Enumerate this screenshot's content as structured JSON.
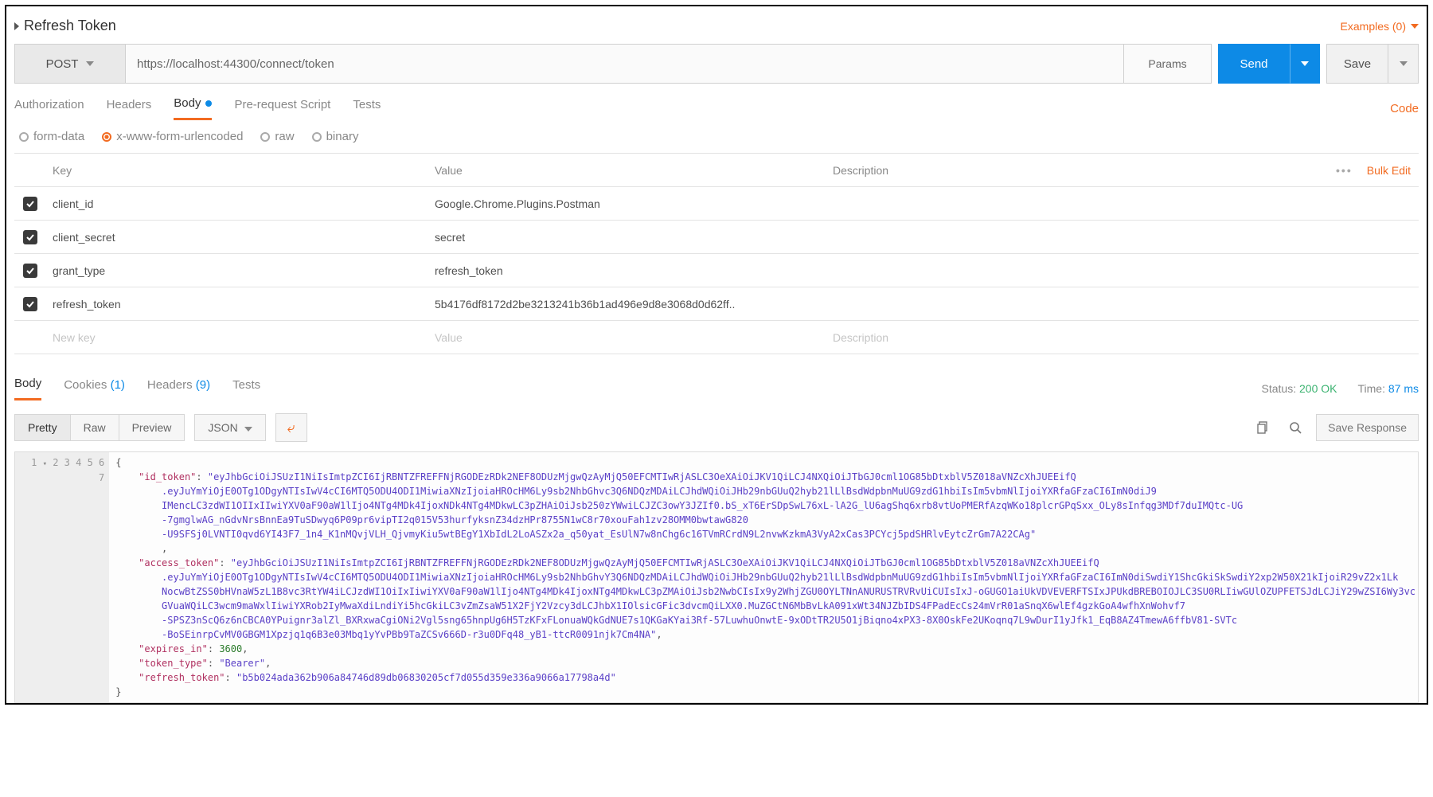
{
  "header": {
    "title": "Refresh Token",
    "examples_label": "Examples (0)"
  },
  "request": {
    "method": "POST",
    "url": "https://localhost:44300/connect/token",
    "params_label": "Params",
    "send_label": "Send",
    "save_label": "Save",
    "tabs": {
      "authorization": "Authorization",
      "headers": "Headers",
      "body": "Body",
      "prerequest": "Pre-request Script",
      "tests": "Tests",
      "code": "Code"
    },
    "body_types": {
      "form_data": "form-data",
      "urlencoded": "x-www-form-urlencoded",
      "raw": "raw",
      "binary": "binary"
    },
    "grid": {
      "headers": {
        "key": "Key",
        "value": "Value",
        "description": "Description",
        "bulk": "Bulk Edit"
      },
      "rows": [
        {
          "enabled": true,
          "key": "client_id",
          "value": "Google.Chrome.Plugins.Postman",
          "description": ""
        },
        {
          "enabled": true,
          "key": "client_secret",
          "value": "secret",
          "description": ""
        },
        {
          "enabled": true,
          "key": "grant_type",
          "value": "refresh_token",
          "description": ""
        },
        {
          "enabled": true,
          "key": "refresh_token",
          "value": "5b4176df8172d2be3213241b36b1ad496e9d8e3068d0d62ff..",
          "description": ""
        }
      ],
      "placeholders": {
        "key": "New key",
        "value": "Value",
        "description": "Description"
      }
    }
  },
  "response": {
    "tabs": {
      "body": "Body",
      "cookies": "Cookies",
      "cookies_count": "(1)",
      "headers": "Headers",
      "headers_count": "(9)",
      "tests": "Tests"
    },
    "status_label": "Status:",
    "status_value": "200 OK",
    "time_label": "Time:",
    "time_value": "87 ms",
    "toolbar": {
      "pretty": "Pretty",
      "raw": "Raw",
      "preview": "Preview",
      "lang": "JSON",
      "save_response": "Save Response"
    },
    "json": {
      "id_token_key": "\"id_token\"",
      "id_token_lines": [
        "\"eyJhbGciOiJSUzI1NiIsImtpZCI6IjRBNTZFREFFNjRGODEzRDk2NEF8ODUzMjgwQzAyMjQ50EFCMTIwRjASLC3OeXAiOiJKV1QiLCJ4NXQiOiJTbGJ0cml1OG85bDtxblV5Z018aVNZcXhJUEEifQ",
        ".eyJuYmYiOjE0OTg1ODgyNTIsIwV4cCI6MTQ5ODU4ODI1MiwiaXNzIjoiaHROcHM6Ly9sb2NhbGhvc3Q6NDQzMDAiLCJhdWQiOiJHb29nbGUuQ2hyb21lLlBsdWdpbnMuUG9zdG1hbiIsIm5vbmNlIjoiYXRfaGFzaCI6ImN0diJ9",
        "IMencLC3zdWI1OIIxIIwiYXV0aF90aW1lIjo4NTg4MDk4IjoxNDk4NTg4MDkwLC3pZHAiOiJsb250zYWwiLCJZC3owY3JZIf0.bS_xT6ErSDpSwL76xL-lA2G_lU6agShq6xrb8vtUoPMERfAzqWKo18plcrGPqSxx_OLy8sInfqg3MDf7duIMQtc-UG",
        "-7gmglwAG_nGdvNrsBnnEa9TuSDwyq6P09pr6vipTI2q015V53hurfyksnZ34dzHPr8755N1wC8r70xouFah1zv28OMM0bwtawG820",
        "-U9SFSj0LVNTI0qvd6YI43F7_1n4_K1nMQvjVLH_QjvmyKiu5wtBEgY1XbIdL2LoASZx2a_q50yat_EsUlN7w8nChg6c16TVmRCrdN9L2nvwKzkmA3VyA2xCas3PCYcj5pdSHRlvEytcZrGm7A22CAg\"",
        ""
      ],
      "access_token_key": "\"access_token\"",
      "access_token_lines": [
        "\"eyJhbGciOiJSUzI1NiIsImtpZCI6IjRBNTZFREFFNjRGODEzRDk2NEF8ODUzMjgwQzAyMjQ50EFCMTIwRjASLC3OeXAiOiJKV1QiLCJ4NXQiOiJTbGJ0cml1OG85bDtxblV5Z018aVNZcXhJUEEifQ",
        ".eyJuYmYiOjE0OTg1ODgyNTIsIwV4cCI6MTQ5ODU4ODI1MiwiaXNzIjoiaHROcHM6Ly9sb2NhbGhvY3Q6NDQzMDAiLCJhdWQiOiJHb29nbGUuQ2hyb21lLlBsdWdpbnMuUG9zdG1hbiIsIm5vbmNlIjoiYXRfaGFzaCI6ImN0diSwdiY1ShcGkiSkSwdiY2xp2W50X21kIjoiR29vZ2x1Lk",
        "NocwBtZSS0bHVnaW5zL1B8vc3RtYW4iLCJzdWI1OiIxIiwiYXV0aF90aW1lIjo4NTg4MDk4IjoxNTg4MDkwLC3pZMAiOiJsb2NwbCIsIx9y2WhjZGU0OYLTNnANURUSTRVRvUiCUIsIxJ-oGUGO1aiUkVDVEVERFTSIxJPUkdBREBOIOJLC3SU0RLIiwGUlOZUPFETSJdLCJiY29wZSI6Wy3vc",
        "GVuaWQiLC3wcm9maWxlIiwiYXRob2IyMwaXdiLndiYi5hcGkiLC3vZmZsaW51X2FjY2Vzcy3dLCJhbX1IOlsicGFic3dvcmQiLXX0.MuZGCtN6MbBvLkA091xWt34NJZbIDS4FPadEcCs24mVrR01aSnqX6wlEf4gzkGoA4wfhXnWohvf7",
        "-SPSZ3nScQ6z6nCBCA0YPuignr3alZl_BXRxwaCgiONi2Vgl5sng65hnpUg6H5TzKFxFLonuaWQkGdNUE7s1QKGaKYai3Rf-57LuwhuOnwtE-9xODtTR2U5O1jBiqno4xPX3-8X0OskFe2UKoqnq7L9wDurI1yJfk1_EqB8AZ4TmewA6ffbV81-SVTc",
        "-BoSEinrpCvMV0GBGM1Xpzjq1q6B3e03Mbq1yYvPBb9TaZCSv666D-r3u0DFq48_yB1-ttcR0091njk7Cm4NA\""
      ],
      "expires_in_key": "\"expires_in\"",
      "expires_in_value": "3600",
      "token_type_key": "\"token_type\"",
      "token_type_value": "\"Bearer\"",
      "refresh_token_key": "\"refresh_token\"",
      "refresh_token_value": "\"b5b024ada362b906a84746d89db06830205cf7d055d359e336a9066a17798a4d\""
    }
  }
}
